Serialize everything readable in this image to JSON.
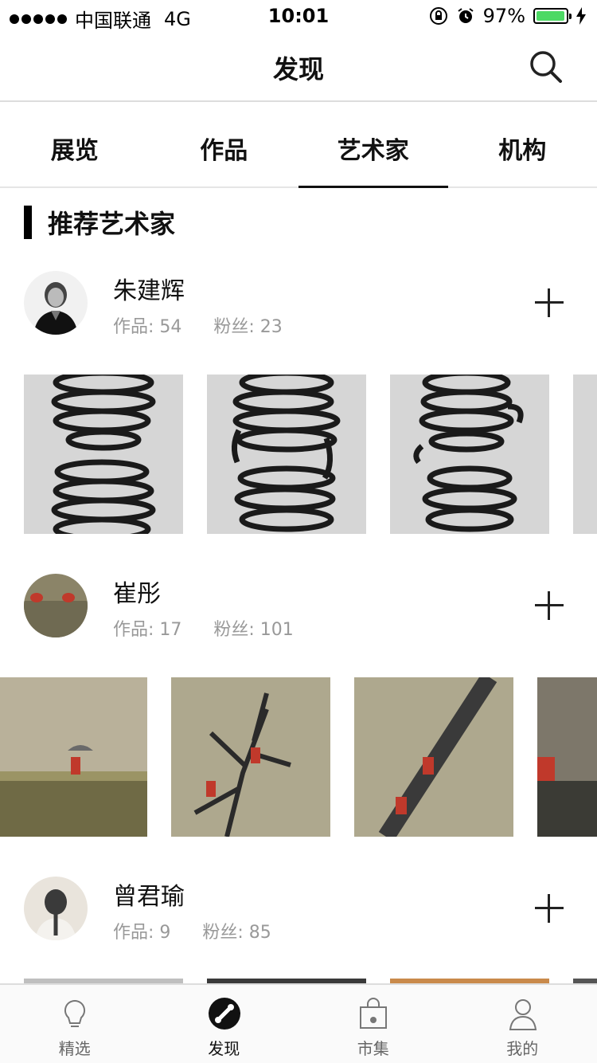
{
  "status_bar": {
    "carrier": "中国联通",
    "network": "4G",
    "time": "10:01",
    "battery": "97%",
    "battery_level": 0.97,
    "battery_color": "#4cd964"
  },
  "navbar": {
    "title": "发现",
    "search_icon": "search-icon"
  },
  "tabs": [
    {
      "label": "展览"
    },
    {
      "label": "作品"
    },
    {
      "label": "艺术家"
    },
    {
      "label": "机构"
    }
  ],
  "active_tab": "艺术家",
  "section": {
    "title": "推荐艺术家"
  },
  "artists": [
    {
      "name": "朱建辉",
      "works": "作品: 54",
      "fans": "粉丝: 23"
    },
    {
      "name": "崔彤",
      "works": "作品: 17",
      "fans": "粉丝: 101"
    },
    {
      "name": "曾君瑜",
      "works": "作品: 9",
      "fans": "粉丝: 85"
    }
  ],
  "tabbar": [
    {
      "label": "精选",
      "icon": "lightbulb-icon"
    },
    {
      "label": "发现",
      "icon": "discover-icon"
    },
    {
      "label": "市集",
      "icon": "shopping-bag-icon"
    },
    {
      "label": "我的",
      "icon": "user-icon"
    }
  ],
  "active_tabbar": "发现"
}
